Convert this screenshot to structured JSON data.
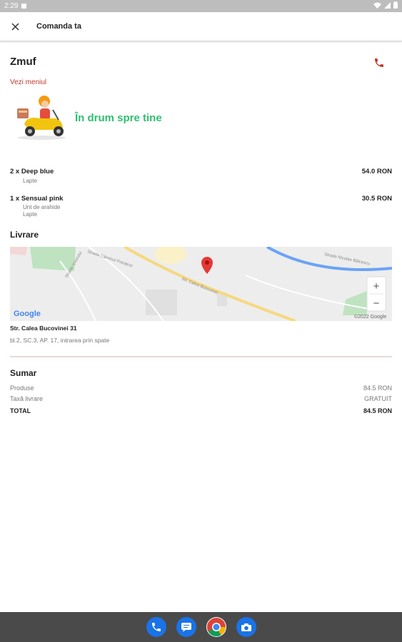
{
  "status_bar": {
    "time": "2:29"
  },
  "header": {
    "title": "Comanda ta"
  },
  "restaurant": {
    "name": "Zmuf",
    "menu_link": "Vezi meniul"
  },
  "order_status": "În drum spre tine",
  "items": [
    {
      "line": "2 x Deep blue",
      "price": "54.0 RON",
      "options": [
        "Lapte"
      ]
    },
    {
      "line": "1 x Sensual pink",
      "price": "30.5 RON",
      "options": [
        "Unt de arahide",
        "Lapte"
      ]
    }
  ],
  "delivery": {
    "title": "Livrare",
    "address_line1": "Str. Calea Bucovinei 31",
    "address_line2": "bl.2, SC.3, AP. 17, intrarea prin spate",
    "map": {
      "streets": [
        "Strada Căminul Preoțesc",
        "Str. Calea Bucovinei",
        "Strada Nicolae Bălcescu",
        "Strada Izvorului"
      ],
      "google_label": "Google",
      "copyright": "©2022 Google",
      "zoom_in": "+",
      "zoom_out": "−"
    }
  },
  "summary": {
    "title": "Sumar",
    "rows": [
      {
        "label": "Produse",
        "value": "84.5 RON"
      },
      {
        "label": "Taxă livrare",
        "value": "GRATUIT"
      }
    ],
    "total_label": "TOTAL",
    "total_value": "84.5 RON"
  },
  "colors": {
    "accent_red": "#c0392b",
    "status_green": "#2fbf71"
  },
  "icons": [
    "close-icon",
    "phone-icon",
    "wifi-icon",
    "battery-icon",
    "map-pin-icon",
    "phone-app-icon",
    "messages-app-icon",
    "chrome-app-icon",
    "camera-app-icon"
  ]
}
